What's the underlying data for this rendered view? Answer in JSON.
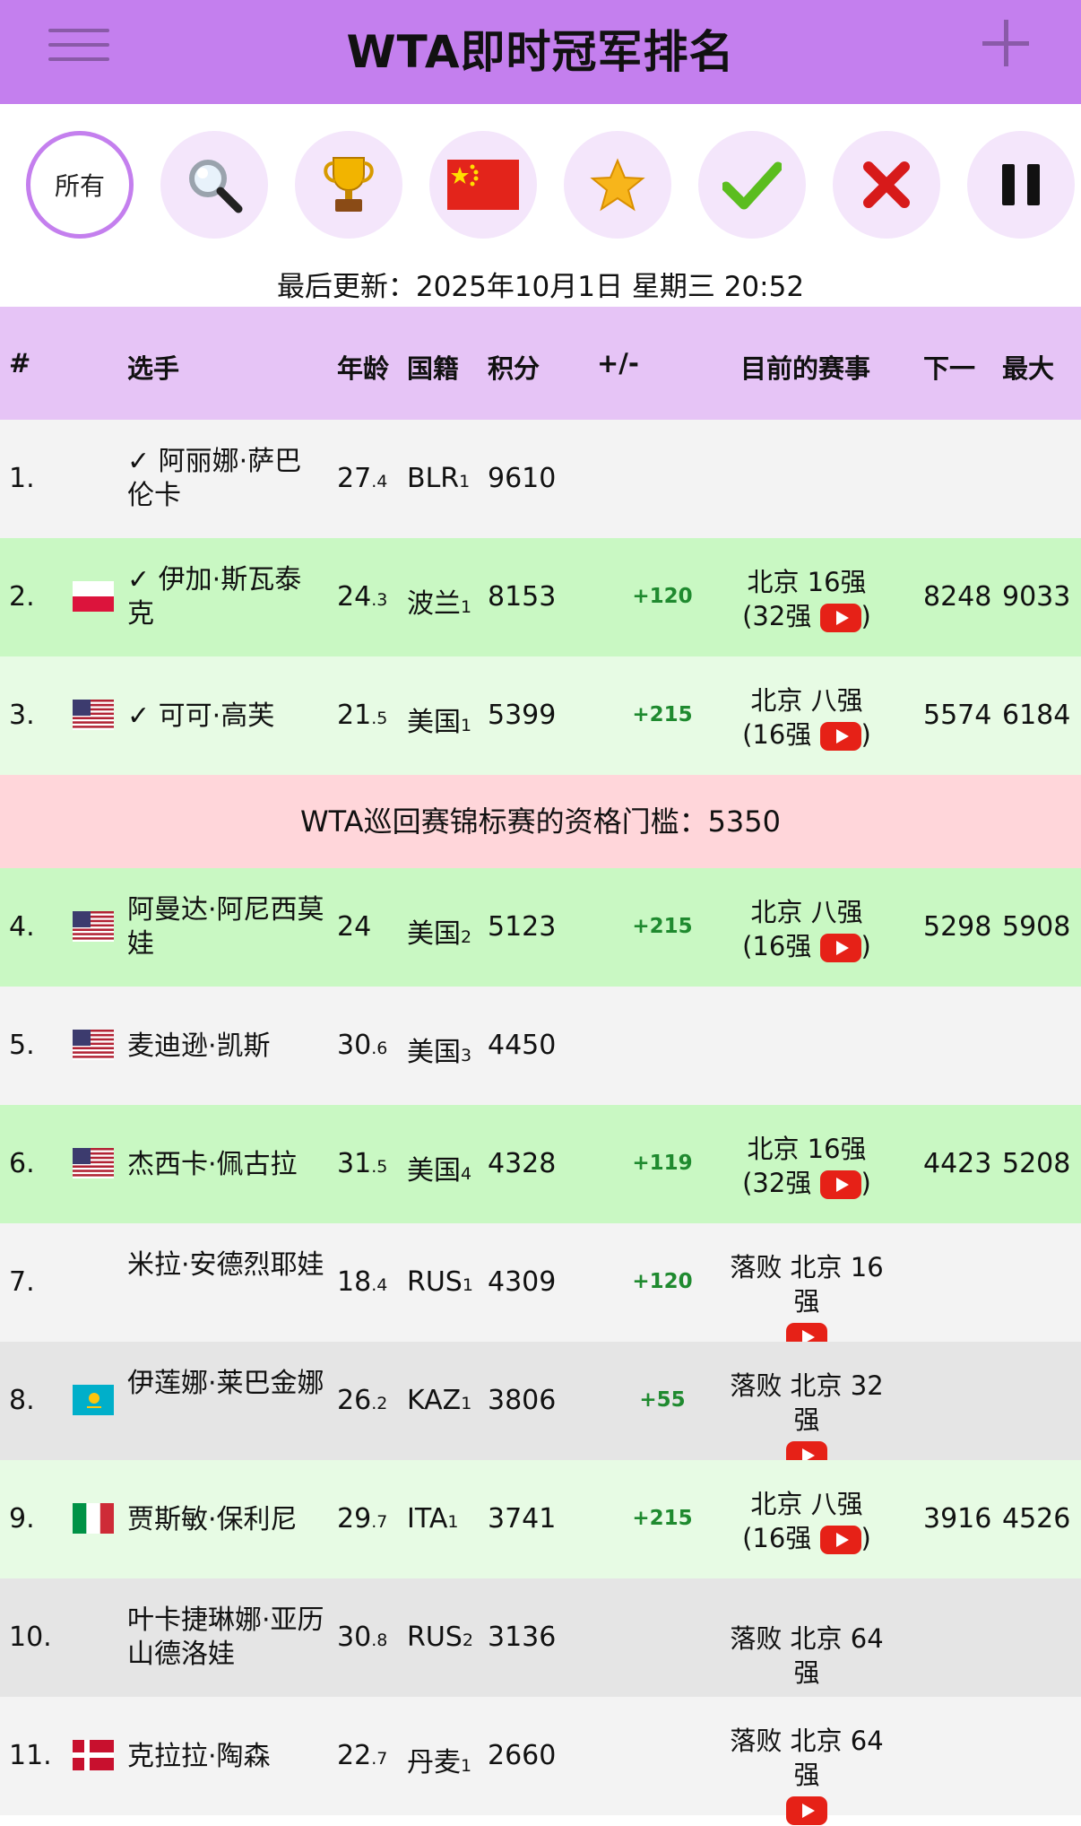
{
  "header": {
    "title": "WTA即时冠军排名",
    "menu_icon": "hamburger-menu-icon",
    "add_icon": "plus-icon",
    "color": "#c47fee"
  },
  "filters": [
    {
      "label": "所有",
      "icon": "all-filter",
      "active": true
    },
    {
      "icon": "magnifier-icon"
    },
    {
      "icon": "trophy-icon"
    },
    {
      "icon": "china-flag-icon"
    },
    {
      "icon": "star-icon"
    },
    {
      "icon": "checkmark-icon"
    },
    {
      "icon": "red-x-icon"
    },
    {
      "icon": "pause-icon"
    }
  ],
  "updated": "最后更新：2025年10月1日 星期三 20:52",
  "columns": {
    "rank": "#",
    "player": "选手",
    "age": "年龄",
    "nationality": "国籍",
    "points": "积分",
    "diff": "+/-",
    "event": "目前的赛事",
    "next": "下一",
    "max": "最大"
  },
  "threshold": "WTA巡回赛锦标赛的资格门槛：5350",
  "players": [
    {
      "rank": "1.",
      "name": "✓ 阿丽娜·萨巴伦卡",
      "age": "27",
      "age_frac": ".4",
      "nat": "BLR",
      "nat_rank": "1",
      "points": "9610",
      "diff": "",
      "event": "",
      "next": "",
      "max": "",
      "flag": "none",
      "row": "white"
    },
    {
      "rank": "2.",
      "name": "✓ 伊加·斯瓦泰克",
      "age": "24",
      "age_frac": ".3",
      "nat": "波兰",
      "nat_rank": "1",
      "points": "8153",
      "diff": "+120",
      "event": "北京 16强",
      "event_prev": "(32强",
      "video": true,
      "next": "8248",
      "max": "9033",
      "flag": "poland",
      "row": "green"
    },
    {
      "rank": "3.",
      "name": "✓ 可可·高芙",
      "age": "21",
      "age_frac": ".5",
      "nat": "美国",
      "nat_rank": "1",
      "points": "5399",
      "diff": "+215",
      "event": "北京 八强",
      "event_prev": "(16强",
      "video": true,
      "next": "5574",
      "max": "6184",
      "flag": "usa",
      "row": "lightgreen"
    },
    {
      "rank": "4.",
      "name": "阿曼达·阿尼西莫娃",
      "age": "24",
      "age_frac": "",
      "nat": "美国",
      "nat_rank": "2",
      "points": "5123",
      "diff": "+215",
      "event": "北京 八强",
      "event_prev": "(16强",
      "video": true,
      "next": "5298",
      "max": "5908",
      "flag": "usa",
      "row": "green"
    },
    {
      "rank": "5.",
      "name": "麦迪逊·凯斯",
      "age": "30",
      "age_frac": ".6",
      "nat": "美国",
      "nat_rank": "3",
      "points": "4450",
      "diff": "",
      "event": "",
      "next": "",
      "max": "",
      "flag": "usa",
      "row": "white"
    },
    {
      "rank": "6.",
      "name": "杰西卡·佩古拉",
      "age": "31",
      "age_frac": ".5",
      "nat": "美国",
      "nat_rank": "4",
      "points": "4328",
      "diff": "+119",
      "event": "北京 16强",
      "event_prev": "(32强",
      "video": true,
      "next": "4423",
      "max": "5208",
      "flag": "usa",
      "row": "green"
    },
    {
      "rank": "7.",
      "name": "米拉·安德烈耶娃",
      "age": "18",
      "age_frac": ".4",
      "nat": "RUS",
      "nat_rank": "1",
      "points": "4309",
      "diff": "+120",
      "event": "落败 北京 16强",
      "event_prev": "",
      "video": true,
      "next": "",
      "max": "",
      "flag": "none",
      "row": "white"
    },
    {
      "rank": "8.",
      "name": "伊莲娜·莱巴金娜",
      "age": "26",
      "age_frac": ".2",
      "nat": "KAZ",
      "nat_rank": "1",
      "points": "3806",
      "diff": "+55",
      "event": "落败 北京 32强",
      "event_prev": "",
      "video": true,
      "next": "",
      "max": "",
      "flag": "kazakhstan",
      "row": "grey"
    },
    {
      "rank": "9.",
      "name": "贾斯敏·保利尼",
      "age": "29",
      "age_frac": ".7",
      "nat": "ITA",
      "nat_rank": "1",
      "points": "3741",
      "diff": "+215",
      "event": "北京 八强",
      "event_prev": "(16强",
      "video": true,
      "next": "3916",
      "max": "4526",
      "flag": "italy",
      "row": "lightgreen"
    },
    {
      "rank": "10.",
      "name": "叶卡捷琳娜·亚历山德洛娃",
      "age": "30",
      "age_frac": ".8",
      "nat": "RUS",
      "nat_rank": "2",
      "points": "3136",
      "diff": "",
      "event": "落败 北京 64强",
      "event_prev": "",
      "video": false,
      "next": "",
      "max": "",
      "flag": "none",
      "row": "grey"
    },
    {
      "rank": "11.",
      "name": "克拉拉·陶森",
      "age": "22",
      "age_frac": ".7",
      "nat": "丹麦",
      "nat_rank": "1",
      "points": "2660",
      "diff": "",
      "event": "落败 北京 64强",
      "event_prev": "",
      "video": true,
      "next": "",
      "max": "",
      "flag": "denmark",
      "row": "white"
    }
  ]
}
